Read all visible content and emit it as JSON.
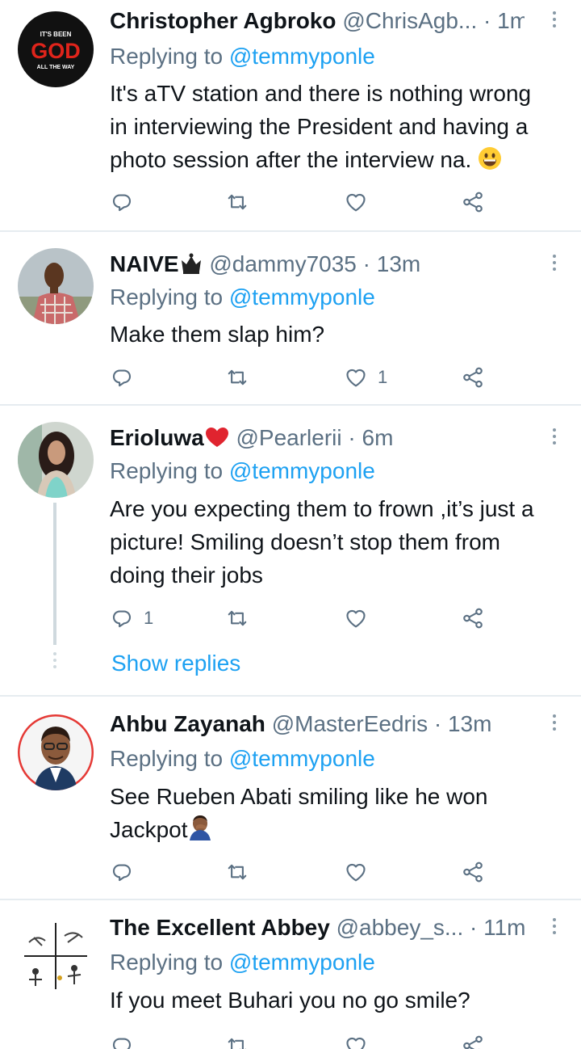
{
  "tweets": [
    {
      "name": "Christopher Agbroko",
      "handle": "@ChrisAgb...",
      "time": "· 1m",
      "replying_prefix": "Replying to",
      "replying_to": "@temmyponle",
      "text_lines": [
        "It's aTV station and there is nothing wrong",
        "in interviewing the President and having a",
        "photo session after the interview na."
      ],
      "avatar_text": {
        "top": "IT'S BEEN",
        "mid": "GOD",
        "bot": "ALL THE WAY"
      },
      "counts": {
        "replies": "",
        "retweets": "",
        "likes": ""
      }
    },
    {
      "name": "NAIVE",
      "handle": "@dammy7035",
      "time": "· 13m",
      "replying_prefix": "Replying to",
      "replying_to": "@temmyponle",
      "text_lines": [
        "Make them slap him?"
      ],
      "counts": {
        "replies": "",
        "retweets": "",
        "likes": "1"
      }
    },
    {
      "name": "Erioluwa",
      "handle": "@Pearlerii",
      "time": "· 6m",
      "replying_prefix": "Replying to",
      "replying_to": "@temmyponle",
      "text_lines": [
        "Are you expecting them to frown ,it’s just a",
        "picture! Smiling doesn’t stop them from",
        "doing their jobs"
      ],
      "counts": {
        "replies": "1",
        "retweets": "",
        "likes": ""
      },
      "show_replies": "Show replies"
    },
    {
      "name": "Ahbu Zayanah",
      "handle": "@MasterEedris",
      "time": "· 13m",
      "replying_prefix": "Replying to",
      "replying_to": "@temmyponle",
      "text_lines": [
        "See Rueben Abati smiling like he won",
        "Jackpot"
      ],
      "counts": {
        "replies": "",
        "retweets": "",
        "likes": ""
      }
    },
    {
      "name": "The Excellent Abbey",
      "handle": "@abbey_s...",
      "time": "· 11m",
      "replying_prefix": "Replying to",
      "replying_to": "@temmyponle",
      "text_lines": [
        "If you meet Buhari you no go smile?"
      ],
      "counts": {
        "replies": "",
        "retweets": "",
        "likes": ""
      }
    }
  ],
  "icons": [
    "reply-icon",
    "retweet-icon",
    "like-icon",
    "share-icon",
    "more-icon"
  ],
  "colors": {
    "link": "#1da1f2",
    "muted": "#5b7083",
    "text": "#0f1419",
    "separator": "#e6ecf0"
  }
}
